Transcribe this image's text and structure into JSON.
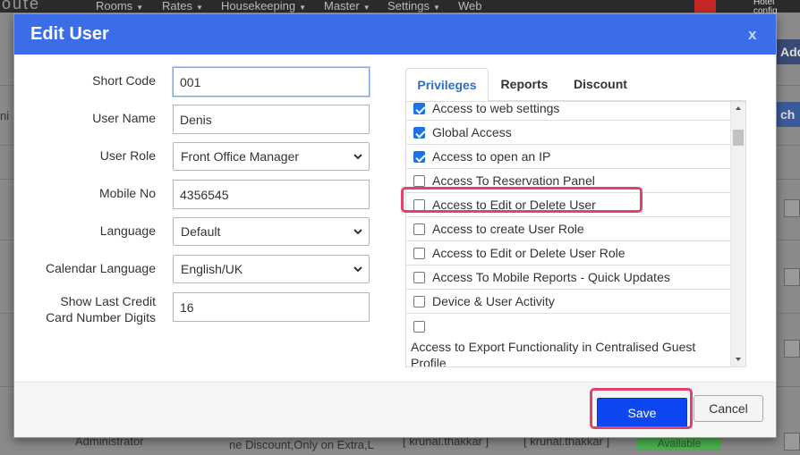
{
  "background": {
    "logo": "oute",
    "menu": [
      "Rooms",
      "Rates",
      "Housekeeping",
      "Master",
      "Settings",
      "Web"
    ],
    "user_line1": "Hotel",
    "user_line2": "config",
    "side_button_label": "Add",
    "side_button_label2": "ch",
    "left_fragment": "ni",
    "bottom_role": "Administrator",
    "bottom_discount": "ne Discount,Only on Extra,L",
    "bottom_user1": "[ krunal.thakkar ]",
    "bottom_user2": "[ krunal.thakkar ]",
    "bottom_status": "Available"
  },
  "modal": {
    "title": "Edit User",
    "close_label": "x"
  },
  "form": {
    "short_code": {
      "label": "Short Code",
      "value": "001"
    },
    "user_name": {
      "label": "User Name",
      "value": "Denis"
    },
    "user_role": {
      "label": "User Role",
      "value": "Front Office Manager"
    },
    "mobile_no": {
      "label": "Mobile No",
      "value": "4356545"
    },
    "language": {
      "label": "Language",
      "value": "Default"
    },
    "calendar_language": {
      "label": "Calendar Language",
      "value": "English/UK"
    },
    "show_last_cc": {
      "label_line1": "Show Last Credit",
      "label_line2": "Card Number Digits",
      "value": "16"
    }
  },
  "tabs": [
    {
      "label": "Privileges",
      "active": true
    },
    {
      "label": "Reports",
      "active": false
    },
    {
      "label": "Discount",
      "active": false
    }
  ],
  "privileges": [
    {
      "label": "Access to web settings",
      "checked": true
    },
    {
      "label": "Global Access",
      "checked": true
    },
    {
      "label": "Access to open an IP",
      "checked": true
    },
    {
      "label": "Access To Reservation Panel",
      "checked": false
    },
    {
      "label": "Access to Edit or Delete User",
      "checked": false
    },
    {
      "label": "Access to create User Role",
      "checked": false
    },
    {
      "label": "Access to Edit or Delete User Role",
      "checked": false
    },
    {
      "label": "Access To Mobile Reports - Quick Updates",
      "checked": false
    },
    {
      "label": "Device & User Activity",
      "checked": false
    },
    {
      "label": "Access to Export Functionality in Centralised Guest Profile",
      "checked": false
    }
  ],
  "footer": {
    "save_label": "Save",
    "cancel_label": "Cancel"
  },
  "colors": {
    "header_blue": "#3b6de8",
    "save_blue": "#0d47f2",
    "highlight_pink": "#e0426b",
    "checkbox_blue": "#1a73e8",
    "active_tab_text": "#2a6fc9"
  }
}
